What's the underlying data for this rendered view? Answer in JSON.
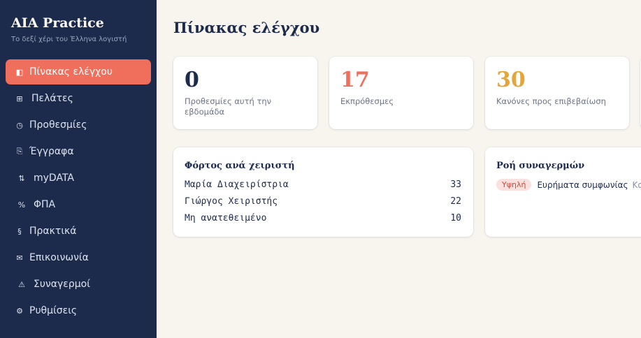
{
  "app": {
    "brand": "AIA Practice",
    "tagline": "Το δεξί χέρι του Έλληνα λογιστή"
  },
  "colors": {
    "sidebar_bg": "#1c2a4b",
    "accent": "#ef6e5c",
    "page_bg": "#f8f5ef",
    "stat_navy": "#1c2a4b",
    "stat_coral": "#ef6e5c",
    "stat_gold": "#e2a63a"
  },
  "sidebar": {
    "items": [
      {
        "label": "Πίνακας ελέγχου",
        "icon": "dashboard-icon",
        "glyph": "◧",
        "active": true
      },
      {
        "label": "Πελάτες",
        "icon": "clients-grid-icon",
        "glyph": "⊞",
        "active": false
      },
      {
        "label": "Προθεσμίες",
        "icon": "clock-icon",
        "glyph": "◷",
        "active": false
      },
      {
        "label": "Έγγραφα",
        "icon": "document-icon",
        "glyph": "⎘",
        "active": false
      },
      {
        "label": "myDATA",
        "icon": "transfer-arrows-icon",
        "glyph": "⇅",
        "active": false
      },
      {
        "label": "ΦΠΑ",
        "icon": "percent-icon",
        "glyph": "%",
        "active": false
      },
      {
        "label": "Πρακτικά",
        "icon": "section-icon",
        "glyph": "§",
        "active": false
      },
      {
        "label": "Επικοινωνία",
        "icon": "mail-icon",
        "glyph": "✉",
        "active": false
      },
      {
        "label": "Συναγερμοί",
        "icon": "warning-icon",
        "glyph": "⚠",
        "active": false
      },
      {
        "label": "Ρυθμίσεις",
        "icon": "gear-icon",
        "glyph": "⚙",
        "active": false
      }
    ]
  },
  "main": {
    "title": "Πίνακας ελέγχου",
    "stats": [
      {
        "value": "0",
        "label": "Προθεσμίες αυτή την εβδομάδα"
      },
      {
        "value": "17",
        "label": "Εκπρόθεσμες"
      },
      {
        "value": "30",
        "label": "Κανόνες προς επιβεβαίωση"
      }
    ],
    "workload": {
      "title": "Φόρτος ανά χειριστή",
      "rows": [
        {
          "name": "Μαρία Διαχειρίστρια",
          "count": "33"
        },
        {
          "name": "Γιώργος Χειριστής",
          "count": "22"
        },
        {
          "name": "Μη ανατεθειμένο",
          "count": "10"
        }
      ]
    },
    "alerts": {
      "title": "Ροή συναγερμών",
      "items": [
        {
          "severity": "Υψηλή",
          "title": "Ευρήματα συμφωνίας",
          "detail": "Καφ"
        }
      ]
    }
  }
}
